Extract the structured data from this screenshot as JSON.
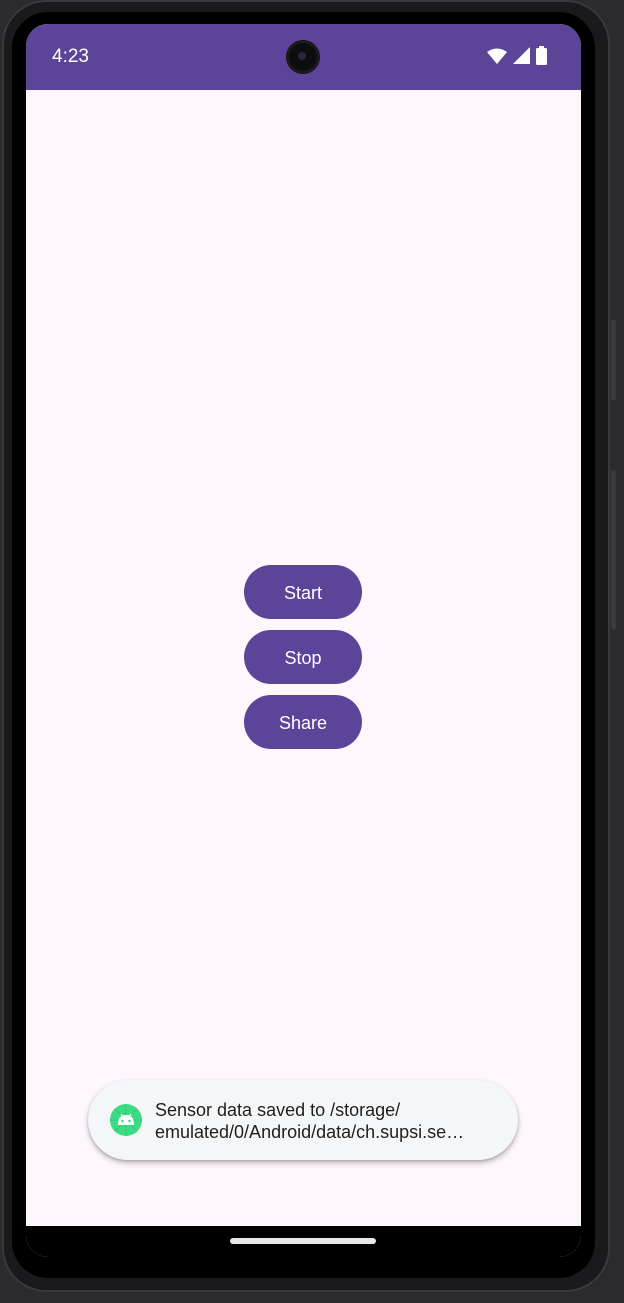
{
  "status_bar": {
    "time": "4:23",
    "icons": [
      "wifi-icon",
      "cellular-signal-icon",
      "battery-icon"
    ],
    "color": "#5c4599"
  },
  "buttons": {
    "start_label": "Start",
    "stop_label": "Stop",
    "share_label": "Share",
    "color": "#5c4599"
  },
  "toast": {
    "icon": "android-icon",
    "line1": "Sensor data saved to /storage/",
    "line2": "emulated/0/Android/data/ch.supsi.se…"
  },
  "theme": {
    "background": "#fef7fc",
    "accent": "#5c4599",
    "toast_icon_color": "#3ddc84"
  }
}
